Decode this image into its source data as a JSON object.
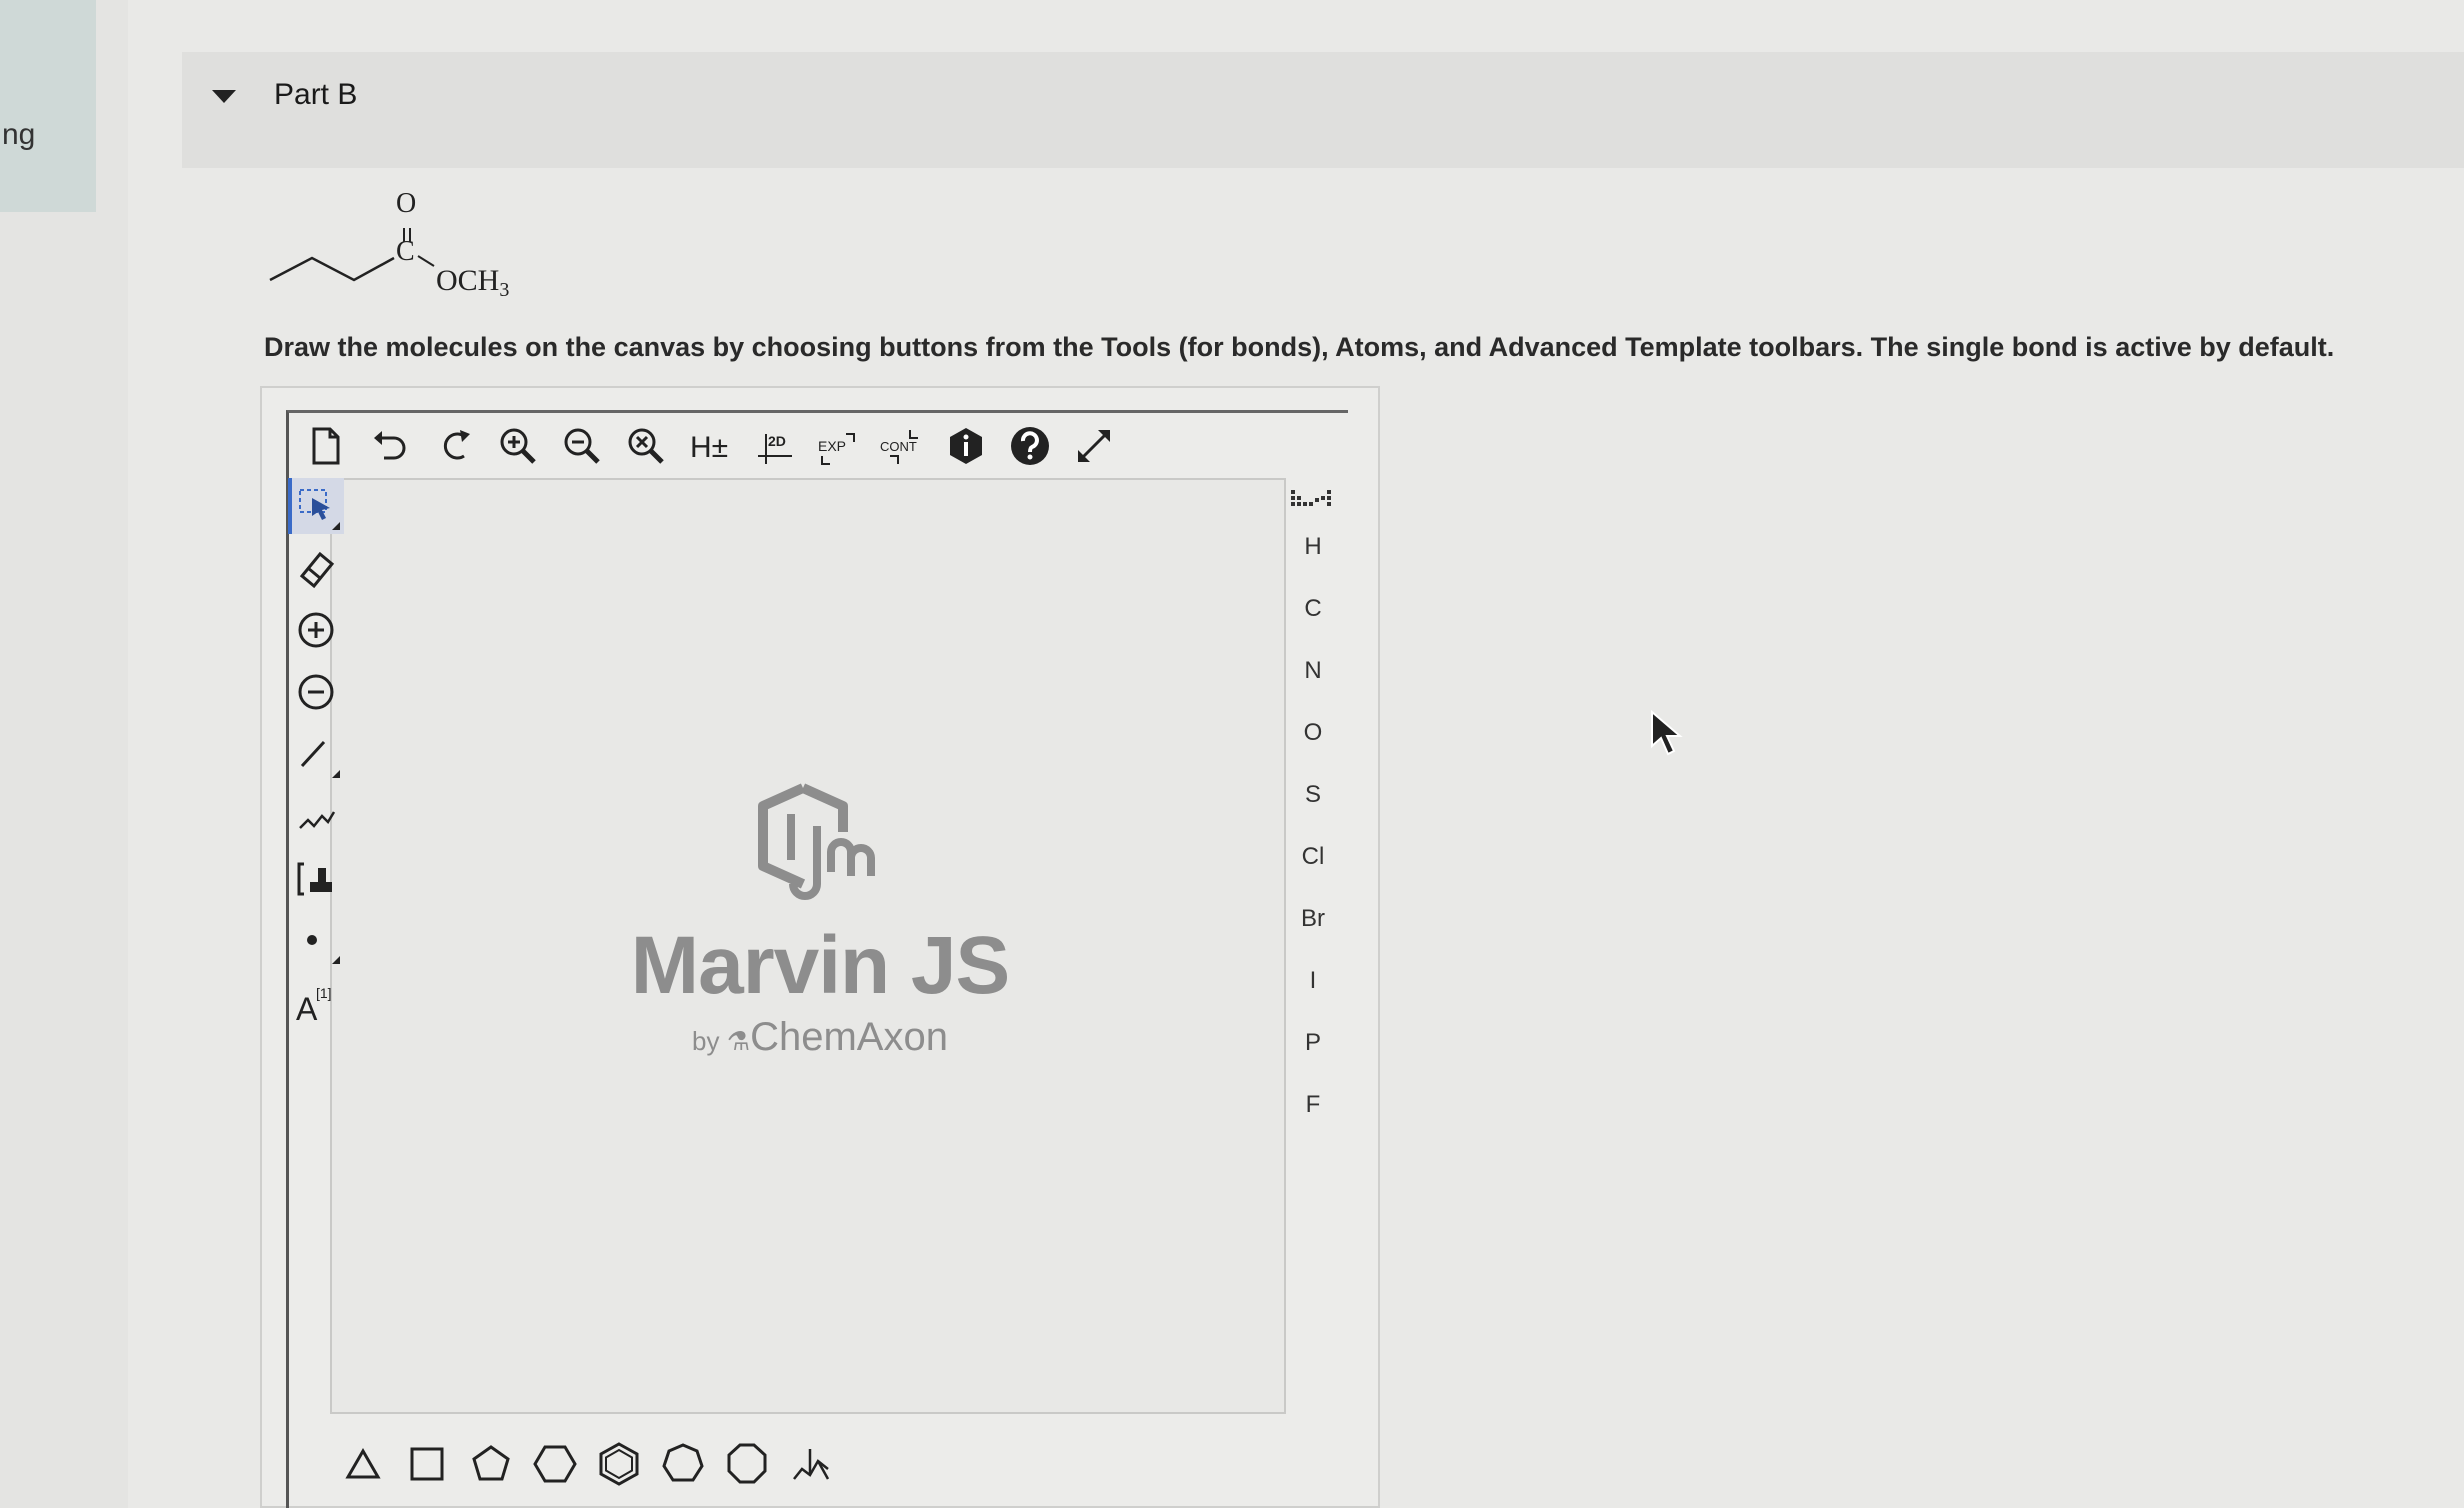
{
  "sidebar": {
    "fragment": "ng"
  },
  "part": {
    "title": "Part B"
  },
  "molecule": {
    "oxygen": "O",
    "carbon": "C",
    "group": "OCH",
    "group_subscript": "3"
  },
  "instructions": "Draw the molecules on the canvas by choosing buttons from the Tools (for bonds), Atoms, and Advanced Template toolbars. The single bond is active by default.",
  "top_toolbar": [
    {
      "name": "new-document-icon"
    },
    {
      "name": "undo-icon"
    },
    {
      "name": "redo-icon"
    },
    {
      "name": "zoom-in-icon"
    },
    {
      "name": "zoom-out-icon"
    },
    {
      "name": "zoom-fit-icon"
    },
    {
      "name": "add-hydrogens-icon",
      "label": "H±"
    },
    {
      "name": "clean-2d-icon",
      "label": "2D"
    },
    {
      "name": "expand-icon",
      "label": "EXP"
    },
    {
      "name": "contract-icon",
      "label": "CONT"
    },
    {
      "name": "info-icon"
    },
    {
      "name": "help-icon"
    },
    {
      "name": "fullscreen-icon"
    }
  ],
  "left_toolbar": [
    {
      "name": "select-icon"
    },
    {
      "name": "eraser-icon"
    },
    {
      "name": "positive-charge-icon"
    },
    {
      "name": "negative-charge-icon"
    },
    {
      "name": "single-bond-icon"
    },
    {
      "name": "chain-icon"
    },
    {
      "name": "bracket-icon"
    },
    {
      "name": "radical-icon"
    },
    {
      "name": "atom-map-icon",
      "label": "A",
      "sup": "[1]"
    }
  ],
  "atoms": [
    "H",
    "C",
    "N",
    "O",
    "S",
    "Cl",
    "Br",
    "I",
    "P",
    "F"
  ],
  "templates": [
    {
      "name": "cyclopropane-icon"
    },
    {
      "name": "cyclobutane-icon"
    },
    {
      "name": "cyclopentane-icon"
    },
    {
      "name": "cyclohexane-icon"
    },
    {
      "name": "benzene-icon"
    },
    {
      "name": "cycloheptane-icon"
    },
    {
      "name": "cyclooctane-icon"
    },
    {
      "name": "template-library-icon"
    }
  ],
  "brand": {
    "product": "Marvin JS",
    "by": "by",
    "company": "ChemAxon"
  },
  "colors": {
    "accent": "#3a6bc8",
    "toolbar_icon": "#222222",
    "brand_gray": "#8d8d8d"
  }
}
